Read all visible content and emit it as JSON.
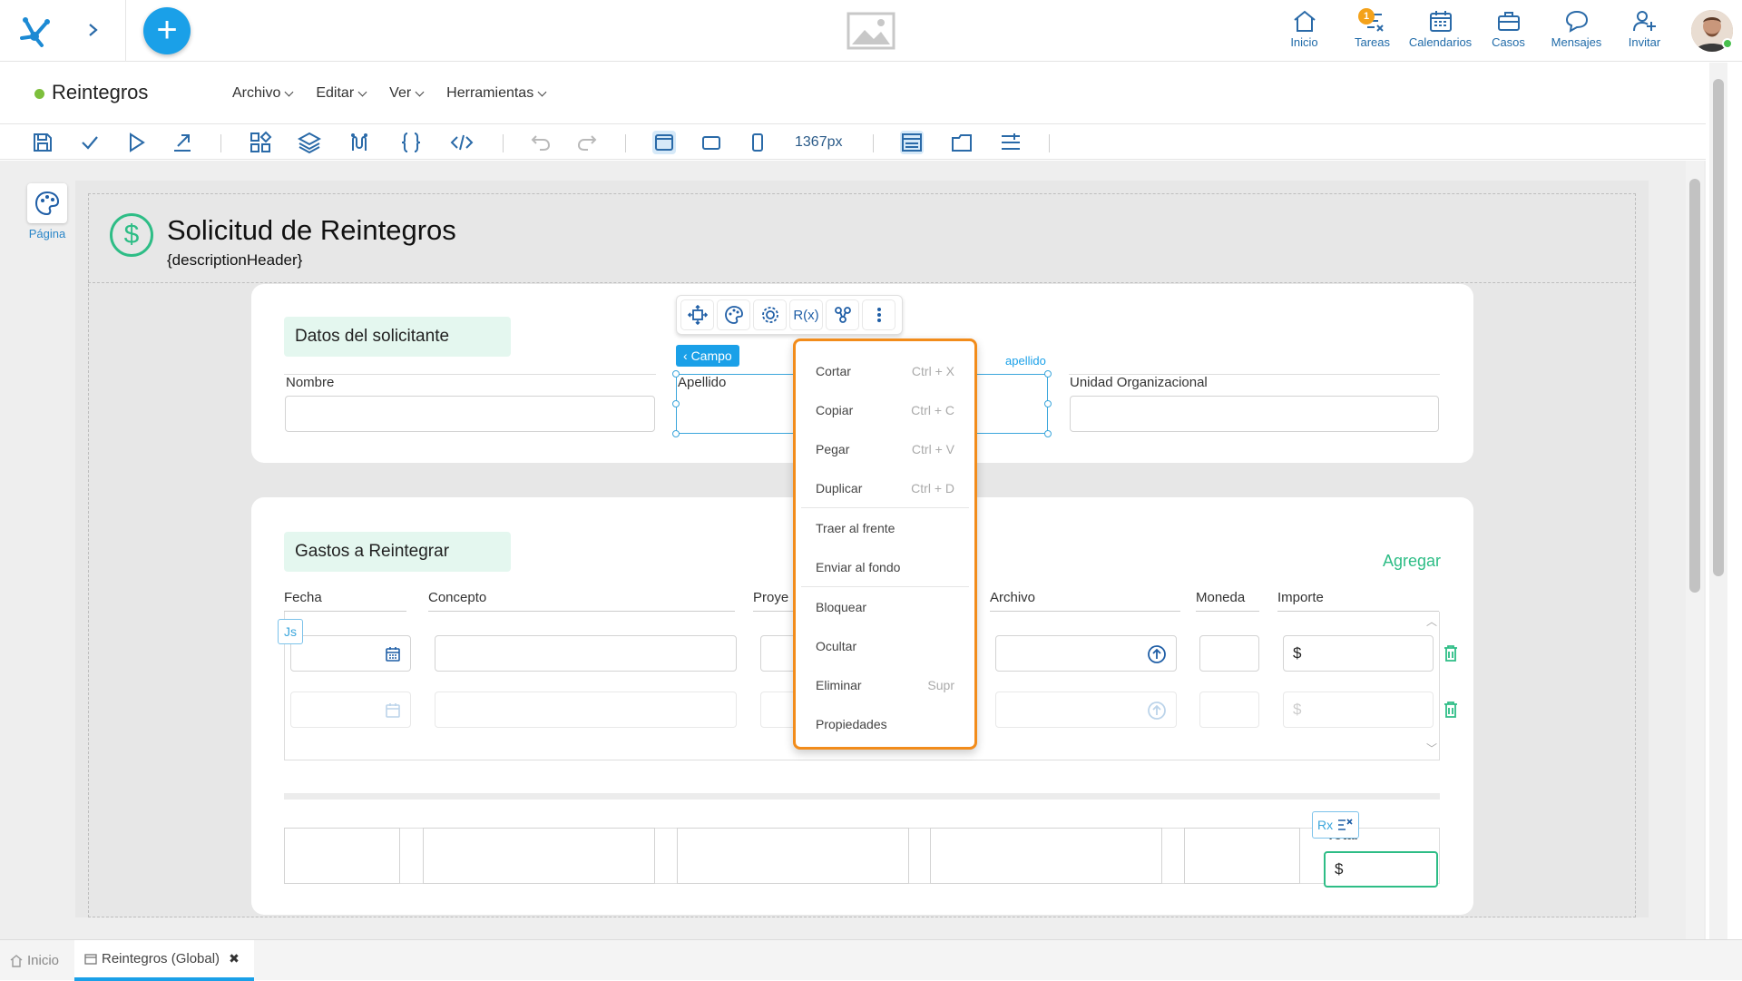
{
  "topbar": {
    "nav": [
      {
        "label": "Inicio",
        "icon": "home-icon"
      },
      {
        "label": "Tareas",
        "icon": "tasks-icon",
        "badge": "1"
      },
      {
        "label": "Calendarios",
        "icon": "calendar-icon"
      },
      {
        "label": "Casos",
        "icon": "briefcase-icon"
      },
      {
        "label": "Mensajes",
        "icon": "chat-icon"
      },
      {
        "label": "Invitar",
        "icon": "add-user-icon"
      }
    ]
  },
  "app": {
    "title": "Reintegros",
    "status_color": "#7dbf3c",
    "menu": [
      "Archivo",
      "Editar",
      "Ver",
      "Herramientas"
    ]
  },
  "toolbar": {
    "width_label": "1367px"
  },
  "sidebar": {
    "page_label": "Página"
  },
  "form": {
    "title": "Solicitud de Reintegros",
    "description": "{descriptionHeader}",
    "section1": {
      "title": "Datos del solicitante",
      "fields": [
        "Nombre",
        "Apellido",
        "Unidad Organizacional"
      ]
    },
    "section2": {
      "title": "Gastos a Reintegrar",
      "add_label": "Agregar",
      "columns": [
        "Fecha",
        "Concepto",
        "Proye",
        "Archivo",
        "Moneda",
        "Importe"
      ],
      "currency_symbol": "$",
      "total_label": "Total"
    }
  },
  "floating_toolbar": {
    "campo_label": "Campo",
    "field_tag": "apellido",
    "rx_label": "R(x)"
  },
  "context_menu": {
    "items": [
      {
        "label": "Cortar",
        "shortcut": "Ctrl + X"
      },
      {
        "label": "Copiar",
        "shortcut": "Ctrl + C"
      },
      {
        "label": "Pegar",
        "shortcut": "Ctrl + V"
      },
      {
        "label": "Duplicar",
        "shortcut": "Ctrl + D"
      },
      {
        "label": "Traer al frente",
        "shortcut": ""
      },
      {
        "label": "Enviar al fondo",
        "shortcut": ""
      },
      {
        "label": "Bloquear",
        "shortcut": ""
      },
      {
        "label": "Ocultar",
        "shortcut": ""
      },
      {
        "label": "Eliminar",
        "shortcut": "Supr"
      },
      {
        "label": "Propiedades",
        "shortcut": ""
      }
    ]
  },
  "tags": {
    "js": "Js",
    "rx": "Rx"
  },
  "bottom_tabs": [
    {
      "label": "Inicio"
    },
    {
      "label": "Reintegros (Global)"
    }
  ],
  "colors": {
    "accent": "#1aa0e8",
    "green": "#2ebd86",
    "menu_border": "#f28c1b"
  }
}
